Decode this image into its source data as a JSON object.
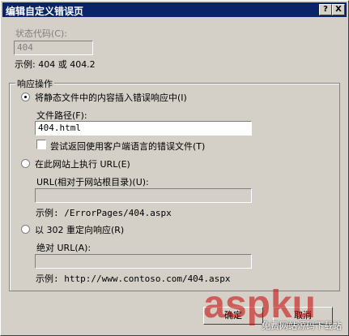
{
  "window": {
    "title": "编辑自定义错误页",
    "help_glyph": "?",
    "close_glyph": "X"
  },
  "status": {
    "label": "状态代码(C):",
    "value": "404",
    "example": "示例: 404 或 404.2"
  },
  "response": {
    "group_title": "响应操作",
    "option1": {
      "label": "将静态文件中的内容插入错误响应中(I)",
      "path_label": "文件路径(F):",
      "path_value": "404.html",
      "checkbox_label": "尝试返回使用客户端语言的错误文件(T)"
    },
    "option2": {
      "label": "在此网站上执行 URL(E)",
      "url_label": "URL(相对于网站根目录)(U):",
      "url_value": "",
      "example": "示例: /ErrorPages/404.aspx"
    },
    "option3": {
      "label": "以 302 重定向响应(R)",
      "url_label": "绝对 URL(A):",
      "url_value": "",
      "example": "示例: http://www.contoso.com/404.aspx"
    }
  },
  "buttons": {
    "ok": "确定",
    "cancel": "取消"
  },
  "watermark": {
    "brand": "aspku",
    "sub": "免费网站源码下载站"
  }
}
